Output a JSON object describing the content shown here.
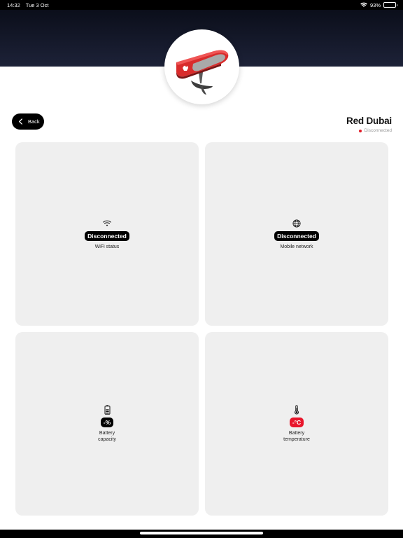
{
  "status_bar": {
    "time": "14:32",
    "date": "Tue 3 Oct",
    "battery_percent": "93%",
    "battery_level": 0.93,
    "icons": [
      "wifi-icon",
      "battery-icon"
    ]
  },
  "nav": {
    "back_label": "Back",
    "back_icon": "chevron-left-icon"
  },
  "device": {
    "name": "Red Dubai",
    "connection_status": "Disconnected",
    "status_color": "#e11d2a",
    "image": "efoil-board-image"
  },
  "cards": {
    "wifi": {
      "icon": "wifi-icon",
      "value": "Disconnected",
      "label": "WiFi status"
    },
    "mobile": {
      "icon": "globe-icon",
      "value": "Disconnected",
      "label": "Mobile network"
    },
    "battery": {
      "icon": "battery-icon",
      "value": "-%",
      "label": "Battery\ncapacity"
    },
    "temperature": {
      "icon": "thermometer-icon",
      "value": "-°C",
      "label": "Battery\ntemperature",
      "badge_color": "#e8152b"
    }
  },
  "colors": {
    "header_top": "#0b0e1a",
    "header_bottom": "#1d2238",
    "card_background": "#efefef",
    "accent_red": "#e8152b"
  }
}
